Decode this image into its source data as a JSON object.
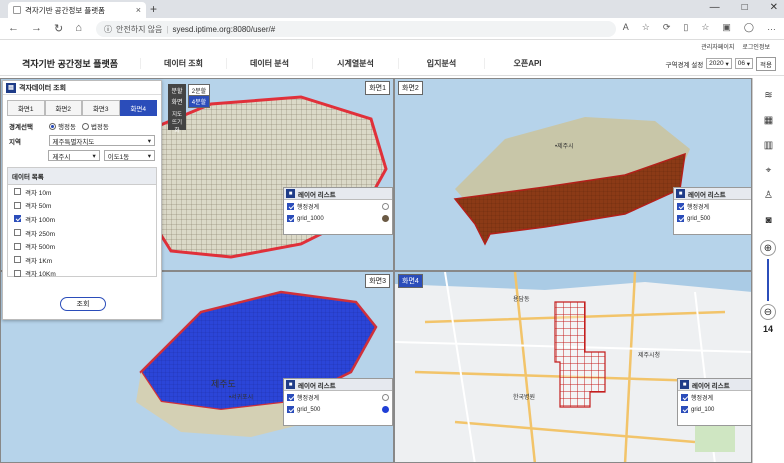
{
  "browser": {
    "tab_title": "격자기반 공간정보 플랫폼",
    "security": "안전하지 않음",
    "url": "syesd.iptime.org:8080/user/#"
  },
  "top_links": [
    "관리자페이지",
    "로그인정보"
  ],
  "header": {
    "logo": "격자기반 공간정보 플랫폼",
    "menu": [
      "데이터 조회",
      "데이터 분석",
      "시계열분석",
      "입지분석",
      "오픈API"
    ],
    "region_label": "구역경계 설정",
    "year": "2020",
    "month": "06",
    "apply_label": "적용"
  },
  "panel": {
    "title": "격자데이터 조회",
    "tabs": [
      "화면1",
      "화면2",
      "화면3",
      "화면4"
    ],
    "active_tab": 3,
    "boundary_label": "경계선택",
    "boundary_options": [
      "행정동",
      "법정동"
    ],
    "region_label": "지역",
    "province": "제주특별자치도",
    "city": "제주시",
    "dong": "이도1동",
    "datalist_title": "데이터 목록",
    "items": [
      {
        "label": "격자 10m",
        "checked": false
      },
      {
        "label": "격자 50m",
        "checked": false
      },
      {
        "label": "격자 100m",
        "checked": true
      },
      {
        "label": "격자 250m",
        "checked": false
      },
      {
        "label": "격자 500m",
        "checked": false
      },
      {
        "label": "격자 1Km",
        "checked": false
      },
      {
        "label": "격자 10Km",
        "checked": false
      }
    ],
    "search_label": "조회"
  },
  "split": {
    "label1": "분할",
    "label2": "화면",
    "opt1": "2분할",
    "opt2": "4분할",
    "map_label": "지도 뜨기화"
  },
  "screens": [
    {
      "label": "화면1",
      "layer_title": "레이어 리스트",
      "layers": [
        {
          "name": "행정경계",
          "color": "#ffffff"
        },
        {
          "name": "grid_1000",
          "color": "#6b5a44"
        }
      ]
    },
    {
      "label": "화면2",
      "layer_title": "레이어 리스트",
      "layers": [
        {
          "name": "행정경계",
          "color": "#ffffff"
        },
        {
          "name": "grid_500",
          "color": "#8b3a16"
        }
      ]
    },
    {
      "label": "화면3",
      "layer_title": "레이어 리스트",
      "layers": [
        {
          "name": "행정경계",
          "color": "#ffffff"
        },
        {
          "name": "grid_500",
          "color": "#1f3fd6"
        }
      ]
    },
    {
      "label": "화면4",
      "layer_title": "레이어 리스트",
      "layers": [
        {
          "name": "행정경계",
          "color": "#ffffff"
        },
        {
          "name": "grid_100",
          "color": "#b01818"
        }
      ]
    }
  ],
  "map_labels": {
    "jeju": "•제주시",
    "seogwipo": "•서귀포시",
    "jeju_do": "제주도",
    "city_hall": "제주시청",
    "airport_area": "용담동",
    "hospital": "한국병원",
    "zoom": "14"
  }
}
